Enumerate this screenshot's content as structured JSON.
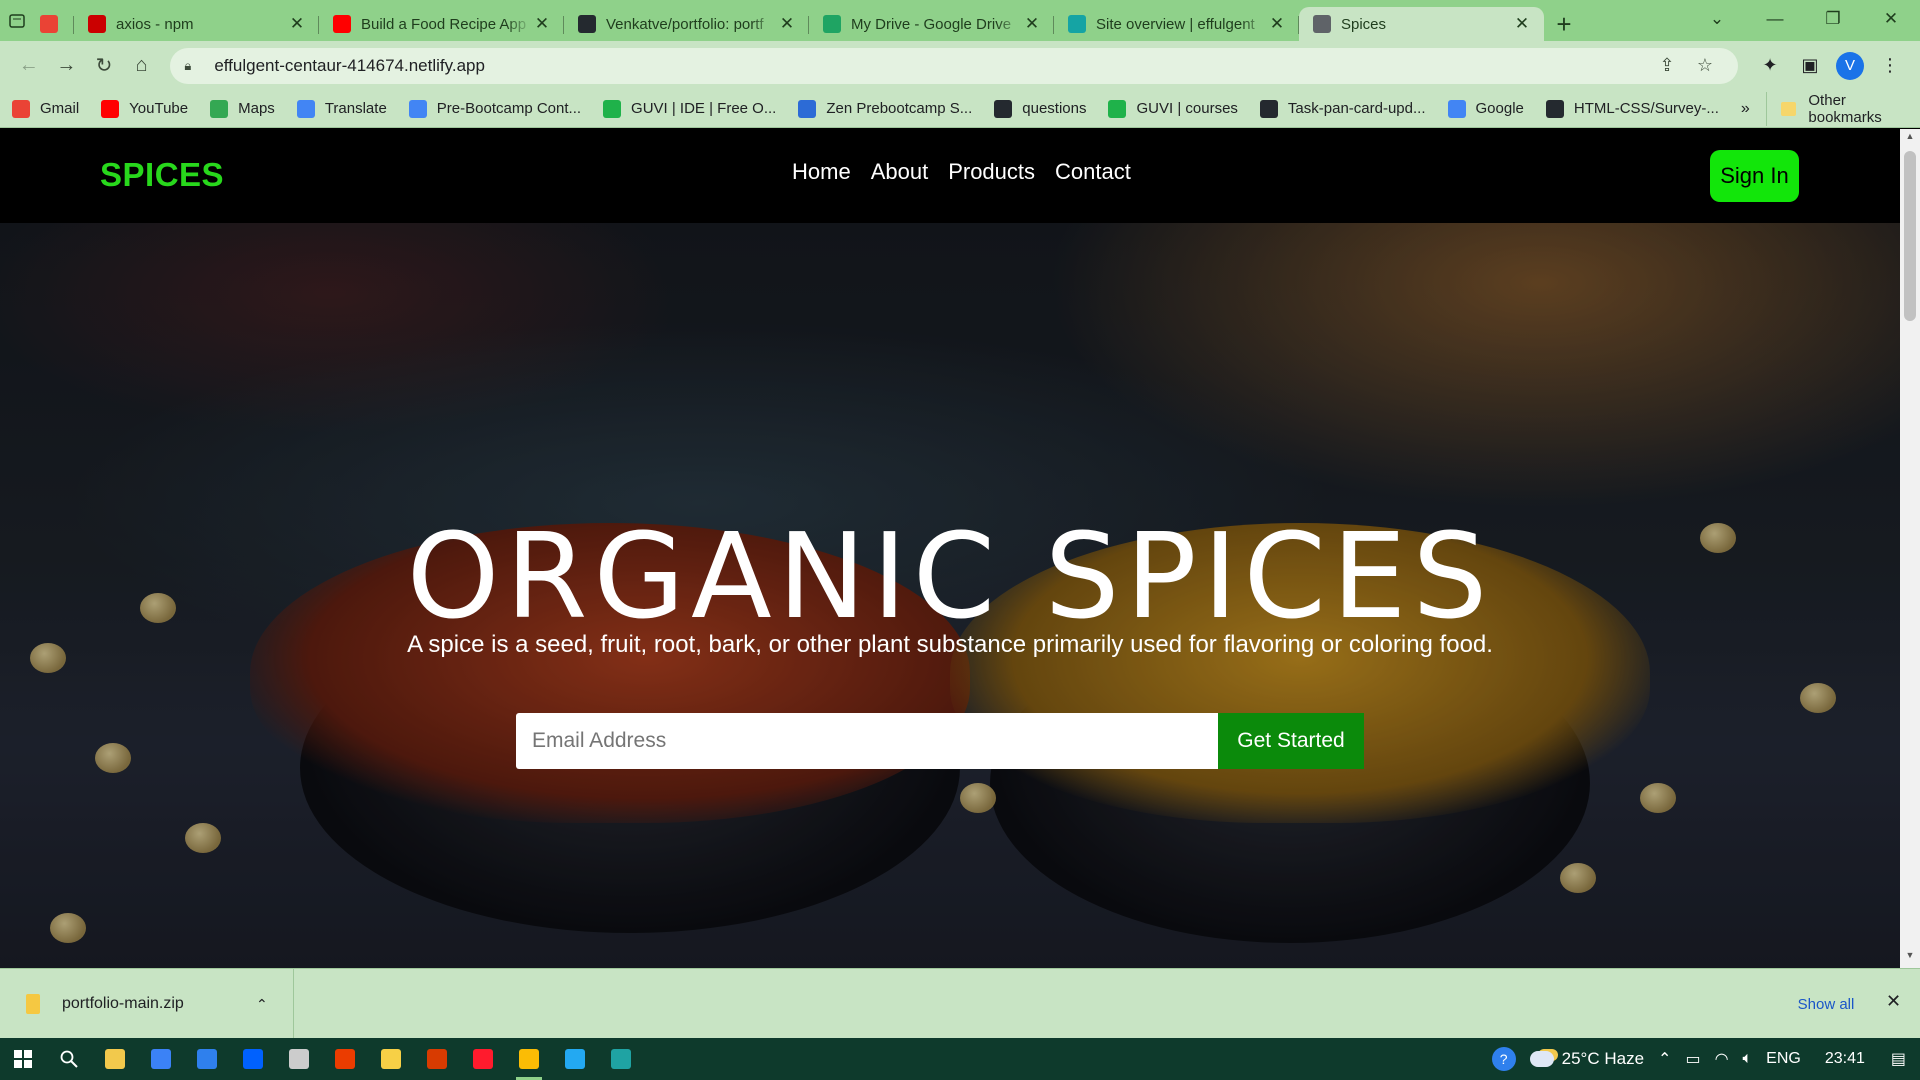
{
  "browser": {
    "tabs": [
      {
        "title": "",
        "favicon": "gmail-icon",
        "color": "#ea4335",
        "narrow": true
      },
      {
        "title": "axios - npm",
        "favicon": "npm-icon",
        "color": "#cb0000"
      },
      {
        "title": "Build a Food Recipe App",
        "favicon": "youtube-icon",
        "color": "#ff0000"
      },
      {
        "title": "Venkatve/portfolio: portf",
        "favicon": "github-icon",
        "color": "#24292f"
      },
      {
        "title": "My Drive - Google Drive",
        "favicon": "google-drive-icon",
        "color": "#1fa463"
      },
      {
        "title": "Site overview | effulgent",
        "favicon": "netlify-icon",
        "color": "#15a4a4"
      },
      {
        "title": "Spices",
        "favicon": "globe-icon",
        "color": "#5f6368",
        "active": true
      }
    ],
    "url": "effulgent-centaur-414674.netlify.app",
    "profile_initial": "V",
    "bookmarks": [
      {
        "label": "Gmail",
        "icon": "gmail-icon",
        "color": "#ea4335"
      },
      {
        "label": "YouTube",
        "icon": "youtube-icon",
        "color": "#ff0000"
      },
      {
        "label": "Maps",
        "icon": "maps-icon",
        "color": "#34a853"
      },
      {
        "label": "Translate",
        "icon": "translate-icon",
        "color": "#4285f4"
      },
      {
        "label": "Pre-Bootcamp Cont...",
        "icon": "docs-icon",
        "color": "#4285f4"
      },
      {
        "label": "GUVI | IDE | Free O...",
        "icon": "guvi-icon",
        "color": "#1fb24a"
      },
      {
        "label": "Zen Prebootcamp S...",
        "icon": "zen-icon",
        "color": "#2c6bd6"
      },
      {
        "label": "questions",
        "icon": "github-icon",
        "color": "#24292f"
      },
      {
        "label": "GUVI | courses",
        "icon": "guvi-icon",
        "color": "#1fb24a"
      },
      {
        "label": "Task-pan-card-upd...",
        "icon": "github-icon",
        "color": "#24292f"
      },
      {
        "label": "Google",
        "icon": "google-icon",
        "color": "#4285f4"
      },
      {
        "label": "HTML-CSS/Survey-...",
        "icon": "github-icon",
        "color": "#24292f"
      }
    ],
    "bookmarks_overflow": "»",
    "other_bookmarks": "Other bookmarks"
  },
  "site": {
    "brand": "SPICES",
    "nav": [
      "Home",
      "About",
      "Products",
      "Contact"
    ],
    "sign_in": "Sign In",
    "hero_title": "ORGANIC SPICES",
    "hero_subtitle": "A spice is a seed, fruit, root, bark, or other plant substance primarily used for flavoring or coloring food.",
    "email_placeholder": "Email Address",
    "cta": "Get Started",
    "colors": {
      "brand": "#28d81c",
      "sign_in_bg": "#12e60a",
      "cta_bg": "#0b8a0b"
    }
  },
  "downloads": {
    "file": "portfolio-main.zip",
    "show_all": "Show all"
  },
  "taskbar": {
    "weather": "25°C  Haze",
    "language": "ENG",
    "time": "23:41",
    "apps": [
      {
        "name": "search-icon",
        "color": ""
      },
      {
        "name": "file-explorer-icon",
        "color": "#f2c94c"
      },
      {
        "name": "store-icon",
        "color": "#3b82f6"
      },
      {
        "name": "mail-icon",
        "color": "#2f80ed"
      },
      {
        "name": "dropbox-icon",
        "color": "#0061fe"
      },
      {
        "name": "settings-icon",
        "color": "#cccccc"
      },
      {
        "name": "office-icon",
        "color": "#eb3c00"
      },
      {
        "name": "sticky-notes-icon",
        "color": "#f7d046"
      },
      {
        "name": "onenote-icon",
        "color": "#d83b01"
      },
      {
        "name": "opera-icon",
        "color": "#ff1b2d"
      },
      {
        "name": "chrome-icon",
        "color": "#fbbc05",
        "active": true
      },
      {
        "name": "vscode-icon",
        "color": "#23a9f2"
      },
      {
        "name": "edge-icon",
        "color": "#1fa3a3"
      }
    ]
  }
}
